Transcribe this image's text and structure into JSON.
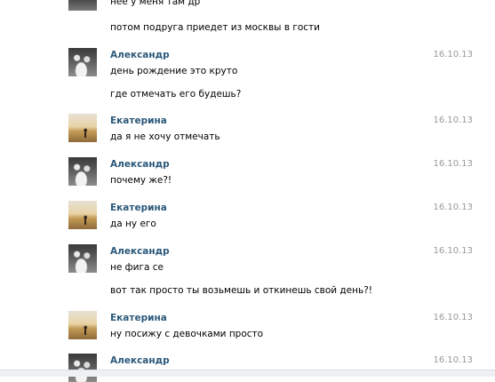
{
  "top_partial": {
    "lines": [
      "нее у меня там др",
      "потом подруга приедет из москвы в гости"
    ]
  },
  "messages": [
    {
      "author": "Александр",
      "date": "16.10.13",
      "lines": [
        "день рождение это круто",
        "где отмечать его будешь?"
      ]
    },
    {
      "author": "Екатерина",
      "date": "16.10.13",
      "lines": [
        "да я не хочу отмечать"
      ]
    },
    {
      "author": "Александр",
      "date": "16.10.13",
      "lines": [
        "почему же?!"
      ]
    },
    {
      "author": "Екатерина",
      "date": "16.10.13",
      "lines": [
        "да ну его"
      ]
    },
    {
      "author": "Александр",
      "date": "16.10.13",
      "lines": [
        "не фига се",
        "вот так просто ты возьмешь и откинешь свой день?!"
      ]
    },
    {
      "author": "Екатерина",
      "date": "16.10.13",
      "lines": [
        "ну посижу с девочками просто"
      ]
    },
    {
      "author": "Александр",
      "date": "16.10.13",
      "lines": []
    }
  ],
  "colors": {
    "author": "#2b587a",
    "date": "#999999"
  }
}
